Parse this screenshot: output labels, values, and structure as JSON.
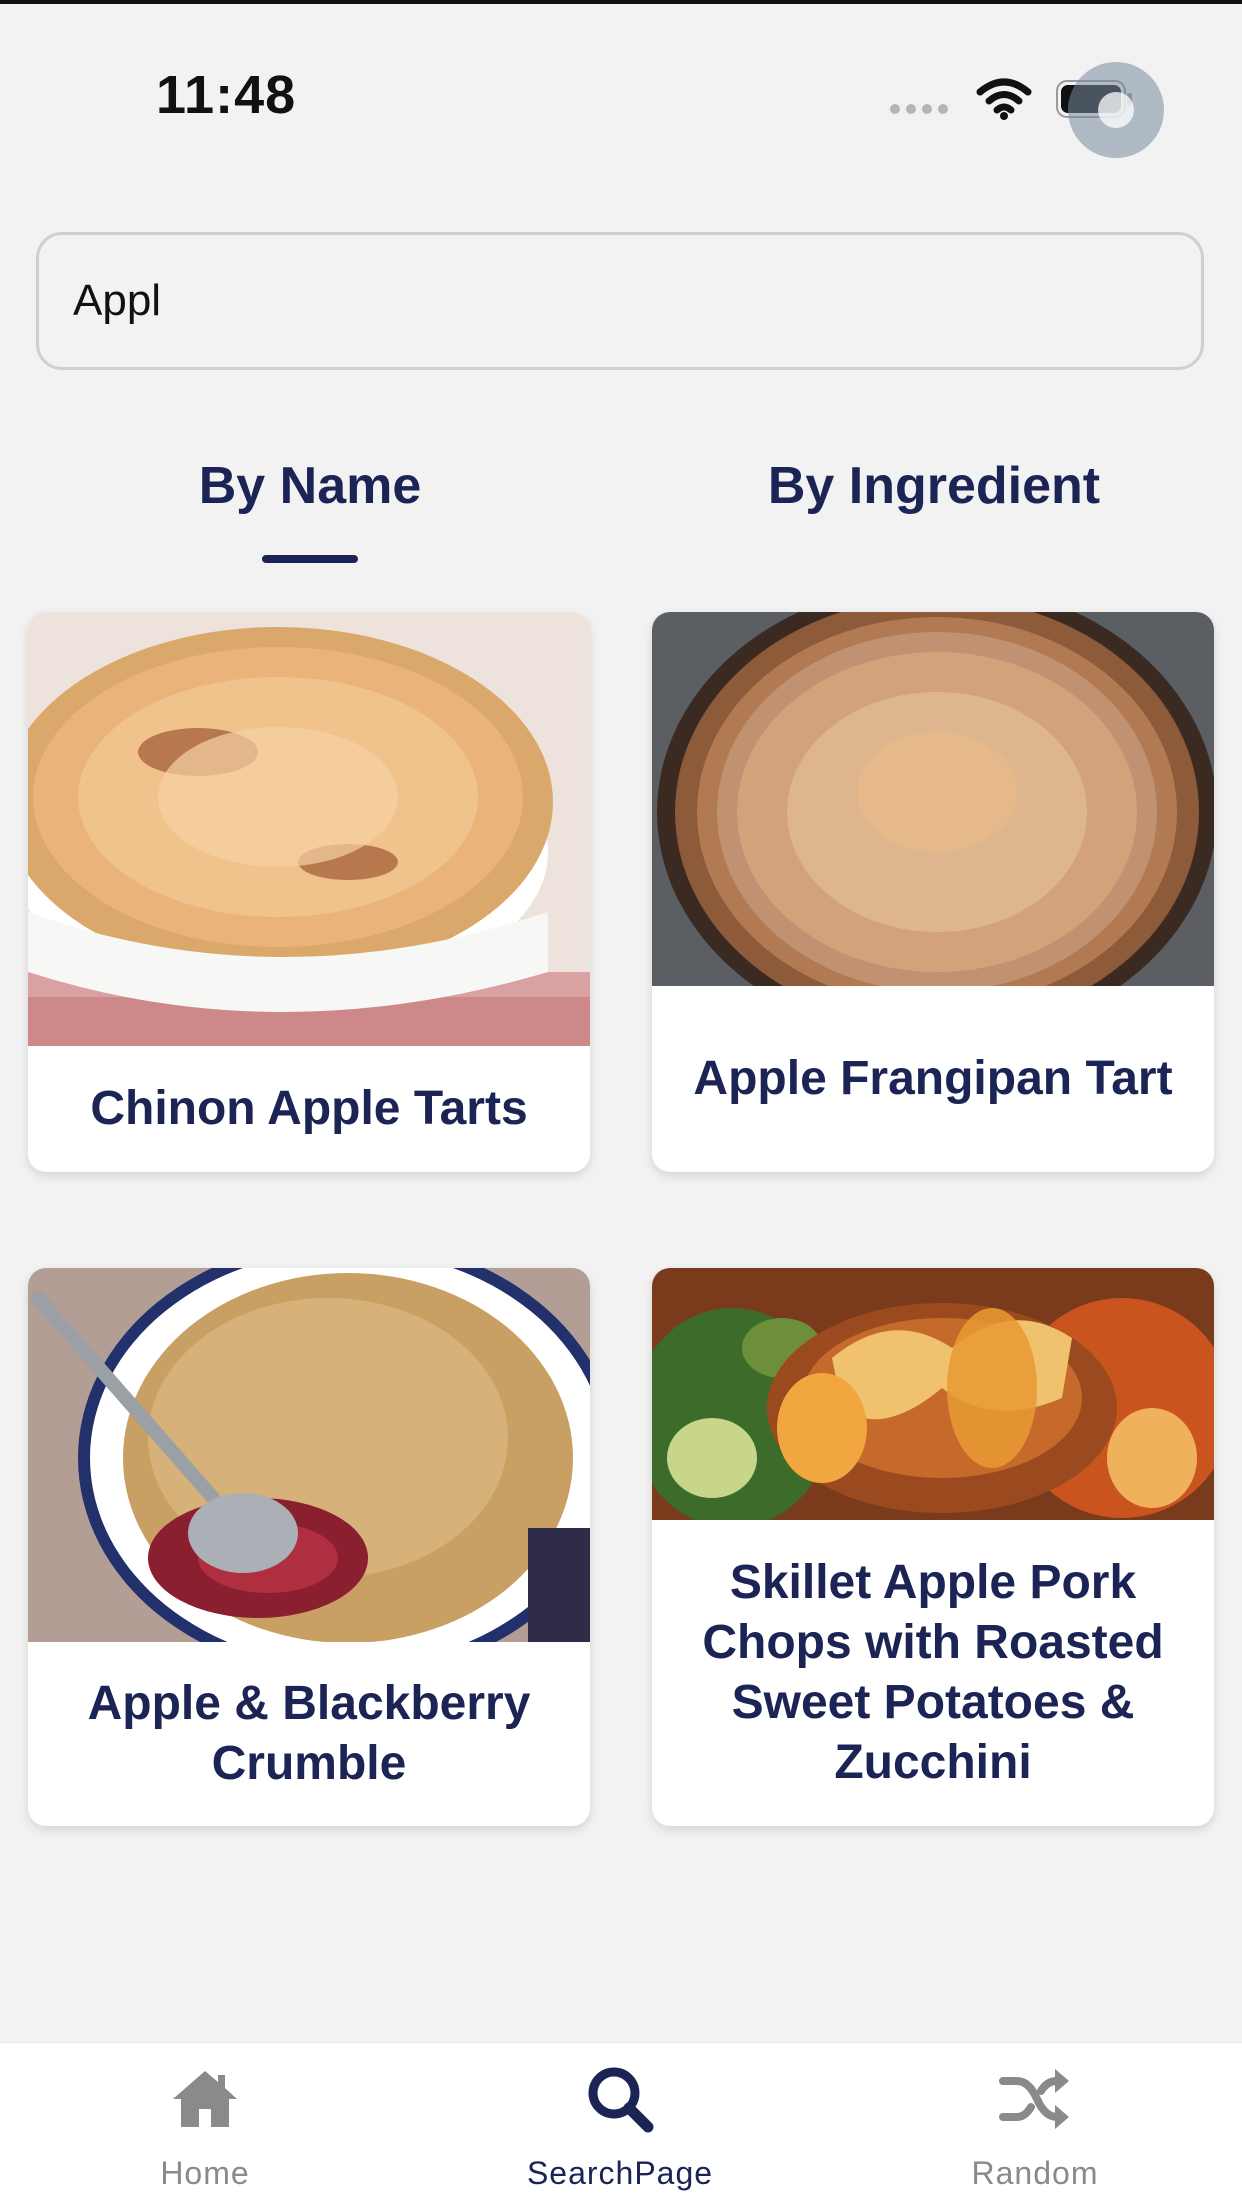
{
  "status_bar": {
    "time": "11:48"
  },
  "search": {
    "value": "Appl",
    "placeholder": ""
  },
  "tabs": [
    {
      "label": "By Name",
      "selected": true
    },
    {
      "label": "By Ingredient",
      "selected": false
    }
  ],
  "results": [
    {
      "title": "Chinon Apple Tarts",
      "image": "apple-tart-photo"
    },
    {
      "title": "Apple Frangipan Tart",
      "image": "frangipane-tart-photo"
    },
    {
      "title": "Apple & Blackberry Crumble",
      "image": "crumble-photo"
    },
    {
      "title": "Skillet Apple Pork Chops with Roasted Sweet Potatoes & Zucchini",
      "image": "pork-chops-photo"
    }
  ],
  "bottom_nav": {
    "items": [
      {
        "label": "Home",
        "icon": "home-icon",
        "active": false
      },
      {
        "label": "SearchPage",
        "icon": "search-icon",
        "active": true
      },
      {
        "label": "Random",
        "icon": "shuffle-icon",
        "active": false
      }
    ]
  },
  "colors": {
    "accent": "#1b2454",
    "background": "#f2f2f2",
    "inactive": "#8a8a8a"
  }
}
